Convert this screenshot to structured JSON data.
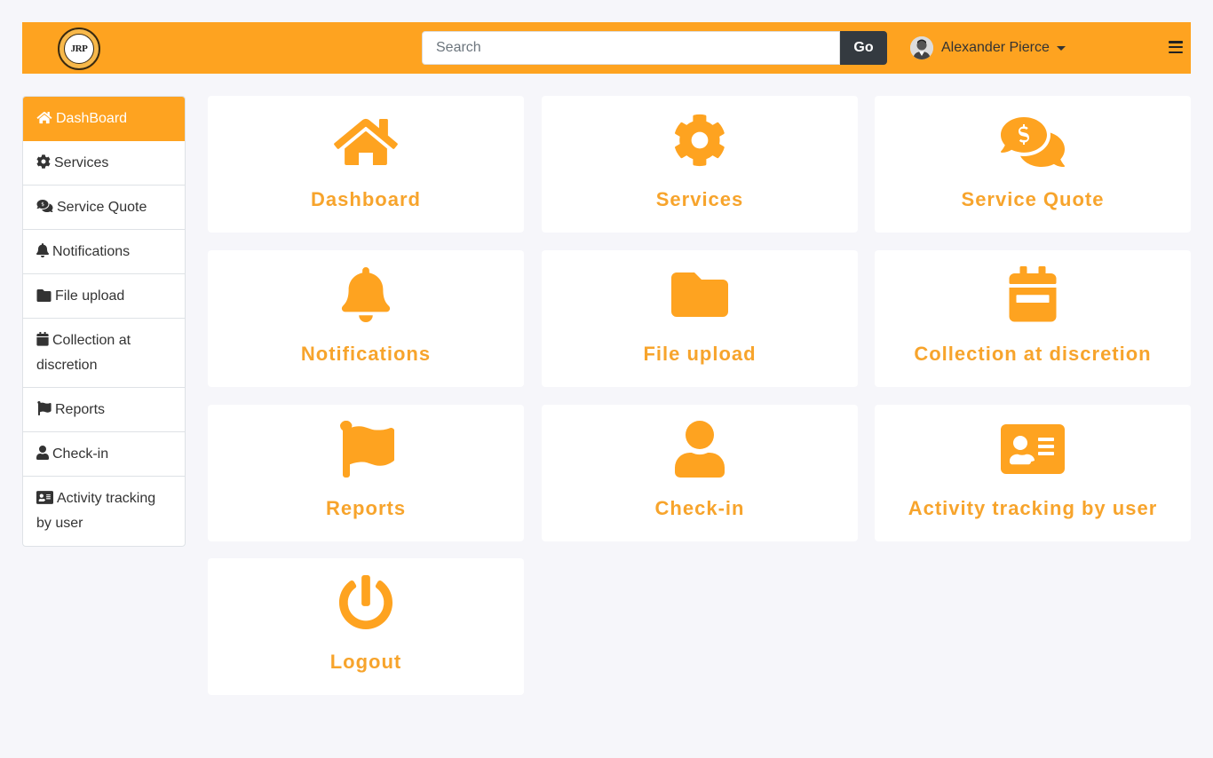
{
  "header": {
    "logo_text": "JRP",
    "search_placeholder": "Search",
    "search_button": "Go",
    "user_name": "Alexander Pierce"
  },
  "colors": {
    "accent": "#fea320",
    "card_text": "#f7a42c",
    "dark": "#343a40"
  },
  "sidebar": {
    "items": [
      {
        "label": "DashBoard",
        "icon": "home-icon"
      },
      {
        "label": "Services",
        "icon": "gear-icon"
      },
      {
        "label": "Service Quote",
        "icon": "comments-dollar-icon"
      },
      {
        "label": "Notifications",
        "icon": "bell-icon"
      },
      {
        "label": "File upload",
        "icon": "folder-icon"
      },
      {
        "label": "Collection at discretion",
        "icon": "calendar-icon"
      },
      {
        "label": "Reports",
        "icon": "flag-icon"
      },
      {
        "label": "Check-in",
        "icon": "user-icon"
      },
      {
        "label": "Activity tracking by user",
        "icon": "id-card-icon"
      }
    ]
  },
  "cards": [
    {
      "label": "Dashboard",
      "icon": "home-icon"
    },
    {
      "label": "Services",
      "icon": "gear-icon"
    },
    {
      "label": "Service Quote",
      "icon": "comments-dollar-icon"
    },
    {
      "label": "Notifications",
      "icon": "bell-icon"
    },
    {
      "label": "File upload",
      "icon": "folder-icon"
    },
    {
      "label": "Collection at discretion",
      "icon": "calendar-icon"
    },
    {
      "label": "Reports",
      "icon": "flag-icon"
    },
    {
      "label": "Check-in",
      "icon": "user-icon"
    },
    {
      "label": "Activity tracking by user",
      "icon": "id-card-icon"
    },
    {
      "label": "Logout",
      "icon": "power-icon"
    }
  ]
}
